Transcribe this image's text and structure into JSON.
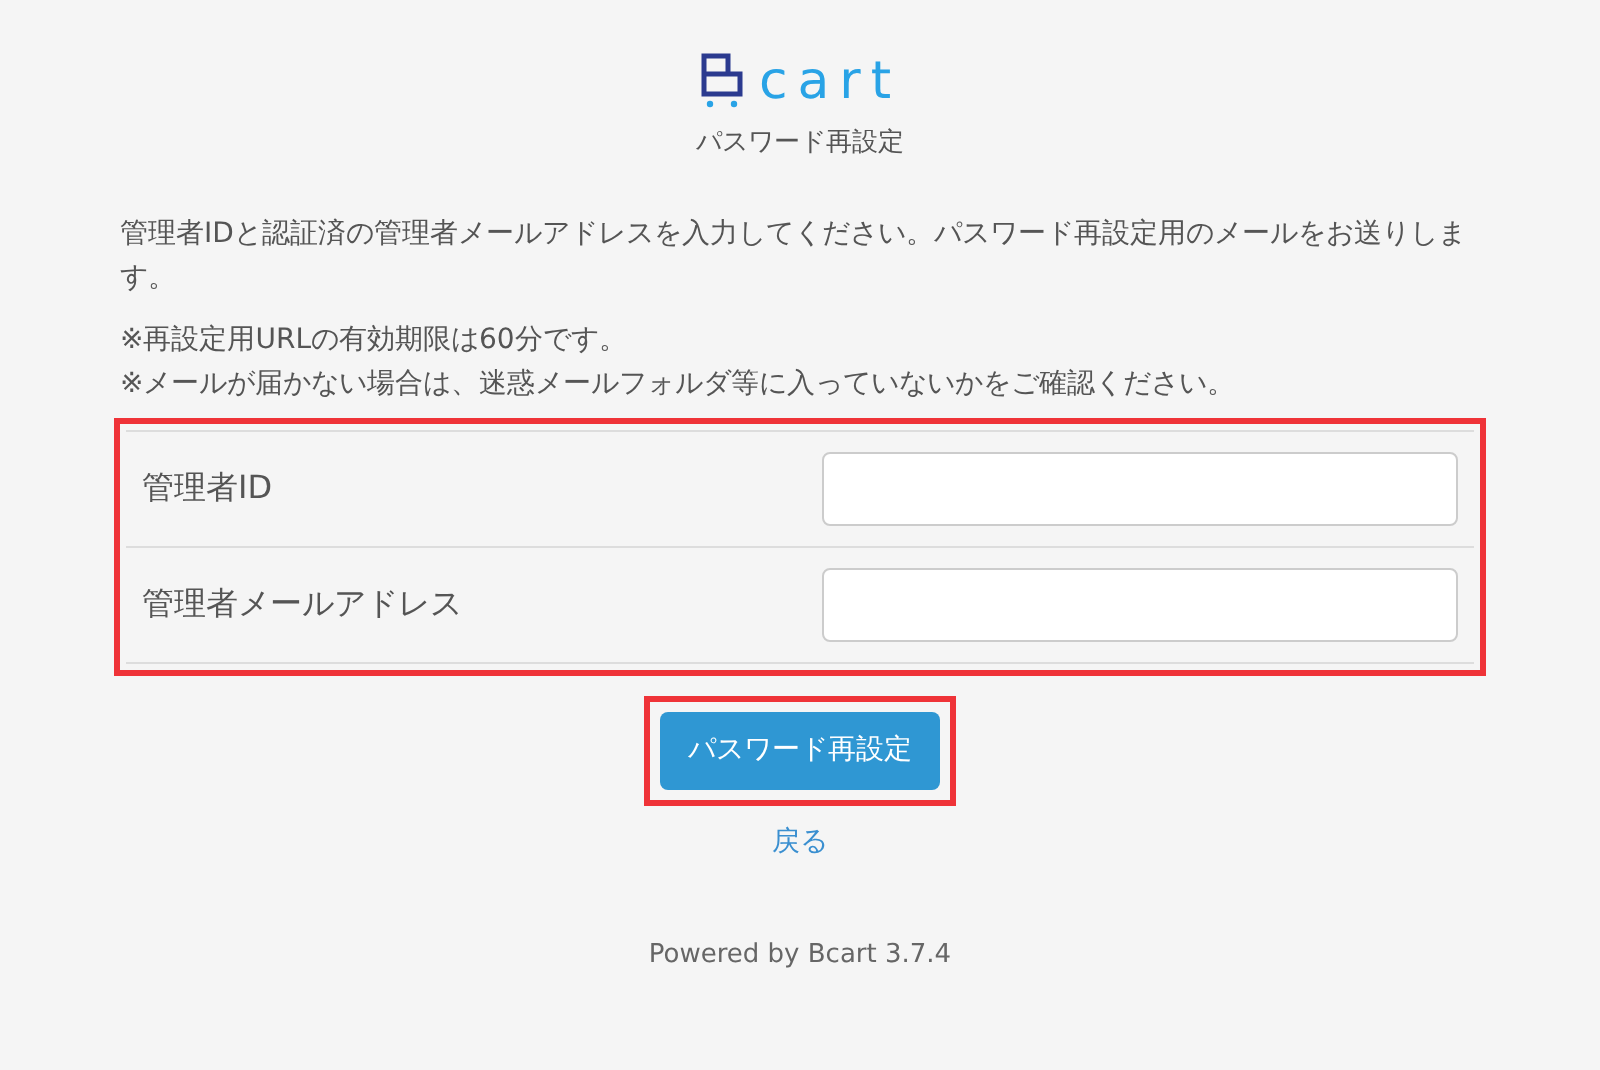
{
  "logo": {
    "text": "cart"
  },
  "subtitle": "パスワード再設定",
  "intro": "管理者IDと認証済の管理者メールアドレスを入力してください。パスワード再設定用のメールをお送りします。",
  "notes": [
    "※再設定用URLの有効期限は60分です。",
    "※メールが届かない場合は、迷惑メールフォルダ等に入っていないかをご確認ください。"
  ],
  "form": {
    "highlighted": true,
    "fields": [
      {
        "label": "管理者ID"
      },
      {
        "label": "管理者メールアドレス"
      }
    ]
  },
  "submit": {
    "label": "パスワード再設定",
    "highlighted": true
  },
  "back_link": "戻る",
  "footer": "Powered by Bcart 3.7.4"
}
